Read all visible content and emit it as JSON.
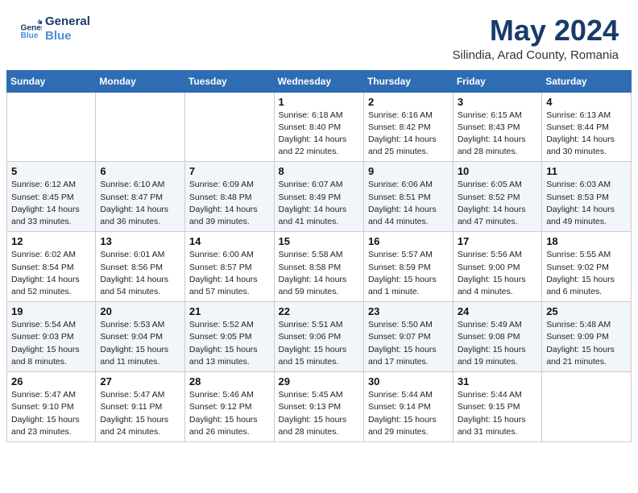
{
  "logo": {
    "line1": "General",
    "line2": "Blue"
  },
  "title": "May 2024",
  "subtitle": "Silindia, Arad County, Romania",
  "days_of_week": [
    "Sunday",
    "Monday",
    "Tuesday",
    "Wednesday",
    "Thursday",
    "Friday",
    "Saturday"
  ],
  "weeks": [
    [
      {
        "day": "",
        "info": ""
      },
      {
        "day": "",
        "info": ""
      },
      {
        "day": "",
        "info": ""
      },
      {
        "day": "1",
        "info": "Sunrise: 6:18 AM\nSunset: 8:40 PM\nDaylight: 14 hours\nand 22 minutes."
      },
      {
        "day": "2",
        "info": "Sunrise: 6:16 AM\nSunset: 8:42 PM\nDaylight: 14 hours\nand 25 minutes."
      },
      {
        "day": "3",
        "info": "Sunrise: 6:15 AM\nSunset: 8:43 PM\nDaylight: 14 hours\nand 28 minutes."
      },
      {
        "day": "4",
        "info": "Sunrise: 6:13 AM\nSunset: 8:44 PM\nDaylight: 14 hours\nand 30 minutes."
      }
    ],
    [
      {
        "day": "5",
        "info": "Sunrise: 6:12 AM\nSunset: 8:45 PM\nDaylight: 14 hours\nand 33 minutes."
      },
      {
        "day": "6",
        "info": "Sunrise: 6:10 AM\nSunset: 8:47 PM\nDaylight: 14 hours\nand 36 minutes."
      },
      {
        "day": "7",
        "info": "Sunrise: 6:09 AM\nSunset: 8:48 PM\nDaylight: 14 hours\nand 39 minutes."
      },
      {
        "day": "8",
        "info": "Sunrise: 6:07 AM\nSunset: 8:49 PM\nDaylight: 14 hours\nand 41 minutes."
      },
      {
        "day": "9",
        "info": "Sunrise: 6:06 AM\nSunset: 8:51 PM\nDaylight: 14 hours\nand 44 minutes."
      },
      {
        "day": "10",
        "info": "Sunrise: 6:05 AM\nSunset: 8:52 PM\nDaylight: 14 hours\nand 47 minutes."
      },
      {
        "day": "11",
        "info": "Sunrise: 6:03 AM\nSunset: 8:53 PM\nDaylight: 14 hours\nand 49 minutes."
      }
    ],
    [
      {
        "day": "12",
        "info": "Sunrise: 6:02 AM\nSunset: 8:54 PM\nDaylight: 14 hours\nand 52 minutes."
      },
      {
        "day": "13",
        "info": "Sunrise: 6:01 AM\nSunset: 8:56 PM\nDaylight: 14 hours\nand 54 minutes."
      },
      {
        "day": "14",
        "info": "Sunrise: 6:00 AM\nSunset: 8:57 PM\nDaylight: 14 hours\nand 57 minutes."
      },
      {
        "day": "15",
        "info": "Sunrise: 5:58 AM\nSunset: 8:58 PM\nDaylight: 14 hours\nand 59 minutes."
      },
      {
        "day": "16",
        "info": "Sunrise: 5:57 AM\nSunset: 8:59 PM\nDaylight: 15 hours\nand 1 minute."
      },
      {
        "day": "17",
        "info": "Sunrise: 5:56 AM\nSunset: 9:00 PM\nDaylight: 15 hours\nand 4 minutes."
      },
      {
        "day": "18",
        "info": "Sunrise: 5:55 AM\nSunset: 9:02 PM\nDaylight: 15 hours\nand 6 minutes."
      }
    ],
    [
      {
        "day": "19",
        "info": "Sunrise: 5:54 AM\nSunset: 9:03 PM\nDaylight: 15 hours\nand 8 minutes."
      },
      {
        "day": "20",
        "info": "Sunrise: 5:53 AM\nSunset: 9:04 PM\nDaylight: 15 hours\nand 11 minutes."
      },
      {
        "day": "21",
        "info": "Sunrise: 5:52 AM\nSunset: 9:05 PM\nDaylight: 15 hours\nand 13 minutes."
      },
      {
        "day": "22",
        "info": "Sunrise: 5:51 AM\nSunset: 9:06 PM\nDaylight: 15 hours\nand 15 minutes."
      },
      {
        "day": "23",
        "info": "Sunrise: 5:50 AM\nSunset: 9:07 PM\nDaylight: 15 hours\nand 17 minutes."
      },
      {
        "day": "24",
        "info": "Sunrise: 5:49 AM\nSunset: 9:08 PM\nDaylight: 15 hours\nand 19 minutes."
      },
      {
        "day": "25",
        "info": "Sunrise: 5:48 AM\nSunset: 9:09 PM\nDaylight: 15 hours\nand 21 minutes."
      }
    ],
    [
      {
        "day": "26",
        "info": "Sunrise: 5:47 AM\nSunset: 9:10 PM\nDaylight: 15 hours\nand 23 minutes."
      },
      {
        "day": "27",
        "info": "Sunrise: 5:47 AM\nSunset: 9:11 PM\nDaylight: 15 hours\nand 24 minutes."
      },
      {
        "day": "28",
        "info": "Sunrise: 5:46 AM\nSunset: 9:12 PM\nDaylight: 15 hours\nand 26 minutes."
      },
      {
        "day": "29",
        "info": "Sunrise: 5:45 AM\nSunset: 9:13 PM\nDaylight: 15 hours\nand 28 minutes."
      },
      {
        "day": "30",
        "info": "Sunrise: 5:44 AM\nSunset: 9:14 PM\nDaylight: 15 hours\nand 29 minutes."
      },
      {
        "day": "31",
        "info": "Sunrise: 5:44 AM\nSunset: 9:15 PM\nDaylight: 15 hours\nand 31 minutes."
      },
      {
        "day": "",
        "info": ""
      }
    ]
  ]
}
